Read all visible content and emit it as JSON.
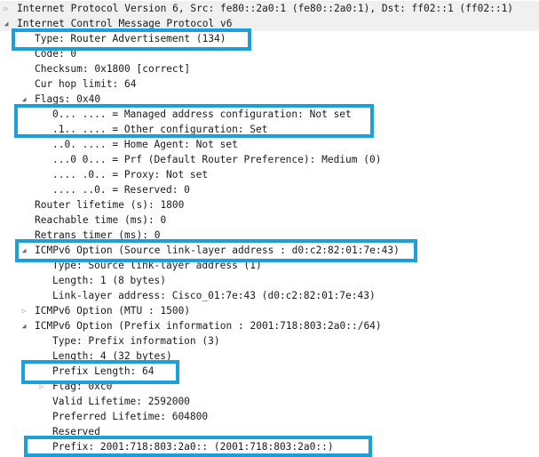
{
  "highlight_color": "#1ca0dc",
  "tree": [
    {
      "label": "Internet Protocol Version 6, Src: fe80::2a0:1 (fe80::2a0:1), Dst: ff02::1 (ff02::1)",
      "state": "collapsed",
      "level": 0
    },
    {
      "label": "Internet Control Message Protocol v6",
      "state": "expanded",
      "level": 0
    },
    {
      "label": "Type: Router Advertisement (134)",
      "level": 1
    },
    {
      "label": "Code: 0",
      "level": 1
    },
    {
      "label": "Checksum: 0x1800 [correct]",
      "level": 1
    },
    {
      "label": "Cur hop limit: 64",
      "level": 1
    },
    {
      "label": "Flags: 0x40",
      "state": "expanded",
      "level": 1
    },
    {
      "label": "0... .... = Managed address configuration: Not set",
      "level": 2
    },
    {
      "label": ".1.. .... = Other configuration: Set",
      "level": 2
    },
    {
      "label": "..0. .... = Home Agent: Not set",
      "level": 2
    },
    {
      "label": "...0 0... = Prf (Default Router Preference): Medium (0)",
      "level": 2
    },
    {
      "label": ".... .0.. = Proxy: Not set",
      "level": 2
    },
    {
      "label": ".... ..0. = Reserved: 0",
      "level": 2
    },
    {
      "label": "Router lifetime (s): 1800",
      "level": 1
    },
    {
      "label": "Reachable time (ms): 0",
      "level": 1
    },
    {
      "label": "Retrans timer (ms): 0",
      "level": 1
    },
    {
      "label": "ICMPv6 Option (Source link-layer address : d0:c2:82:01:7e:43)",
      "state": "expanded",
      "level": 1
    },
    {
      "label": "Type: Source link-layer address (1)",
      "level": 2
    },
    {
      "label": "Length: 1 (8 bytes)",
      "level": 2
    },
    {
      "label": "Link-layer address: Cisco_01:7e:43 (d0:c2:82:01:7e:43)",
      "level": 2
    },
    {
      "label": "ICMPv6 Option (MTU : 1500)",
      "state": "collapsed",
      "level": 1
    },
    {
      "label": "ICMPv6 Option (Prefix information : 2001:718:803:2a0::/64)",
      "state": "expanded",
      "level": 1
    },
    {
      "label": "Type: Prefix information (3)",
      "level": 2
    },
    {
      "label": "Length: 4 (32 bytes)",
      "level": 2
    },
    {
      "label": "Prefix Length: 64",
      "level": 2
    },
    {
      "label": "Flag: 0xc0",
      "state": "collapsed",
      "level": 2
    },
    {
      "label": "Valid Lifetime: 2592000",
      "level": 2
    },
    {
      "label": "Preferred Lifetime: 604800",
      "level": 2
    },
    {
      "label": "Reserved",
      "level": 2
    },
    {
      "label": "Prefix: 2001:718:803:2a0:: (2001:718:803:2a0::)",
      "level": 2
    }
  ],
  "highlighted_fields": [
    "Type: Router Advertisement (134)",
    "Managed address configuration / Other configuration flags",
    "ICMPv6 Option (Source link-layer address)",
    "Prefix Length: 64",
    "Prefix: 2001:718:803:2a0::"
  ]
}
